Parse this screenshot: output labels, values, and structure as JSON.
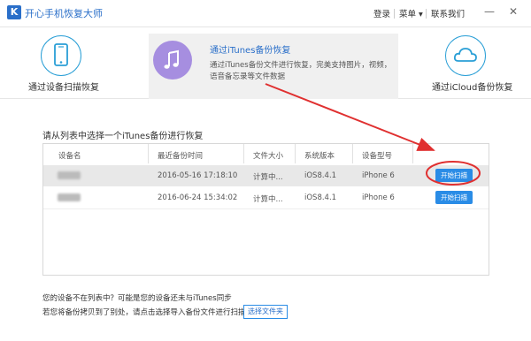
{
  "app": {
    "logo_letter": "K",
    "title": "开心手机恢复大师"
  },
  "titlebar": {
    "login": "登录",
    "menu": "菜单 ▾",
    "contact": "联系我们",
    "minimize": "—",
    "close": "✕"
  },
  "modes": {
    "device_scan": "通过设备扫描恢复",
    "itunes": {
      "title": "通过iTunes备份恢复",
      "desc_1": "通过iTunes备份文件进行恢复，完美支持图片，视频，",
      "desc_2": "语音备忘录等文件数据"
    },
    "icloud": "通过iCloud备份恢复"
  },
  "backup_list": {
    "heading": "请从列表中选择一个iTunes备份进行恢复",
    "columns": [
      "设备名",
      "最近备份时间",
      "文件大小",
      "系统版本",
      "设备型号"
    ],
    "rows": [
      {
        "time": "2016-05-16 17:18:10",
        "size": "计算中...",
        "os": "iOS8.4.1",
        "model": "iPhone 6",
        "button": "开始扫描"
      },
      {
        "time": "2016-06-24 15:34:02",
        "size": "计算中...",
        "os": "iOS8.4.1",
        "model": "iPhone 6",
        "button": "开始扫描"
      }
    ]
  },
  "footer": {
    "line1": "您的设备不在列表中？可能是您的设备还未与iTunes同步",
    "line2": "若您将备份拷贝到了别处，请点击选择导入备份文件进行扫描",
    "choose_folder": "选择文件夹"
  },
  "colors": {
    "brand": "#2a6fc9",
    "button": "#2a8ce6",
    "annotation": "#e03030"
  }
}
